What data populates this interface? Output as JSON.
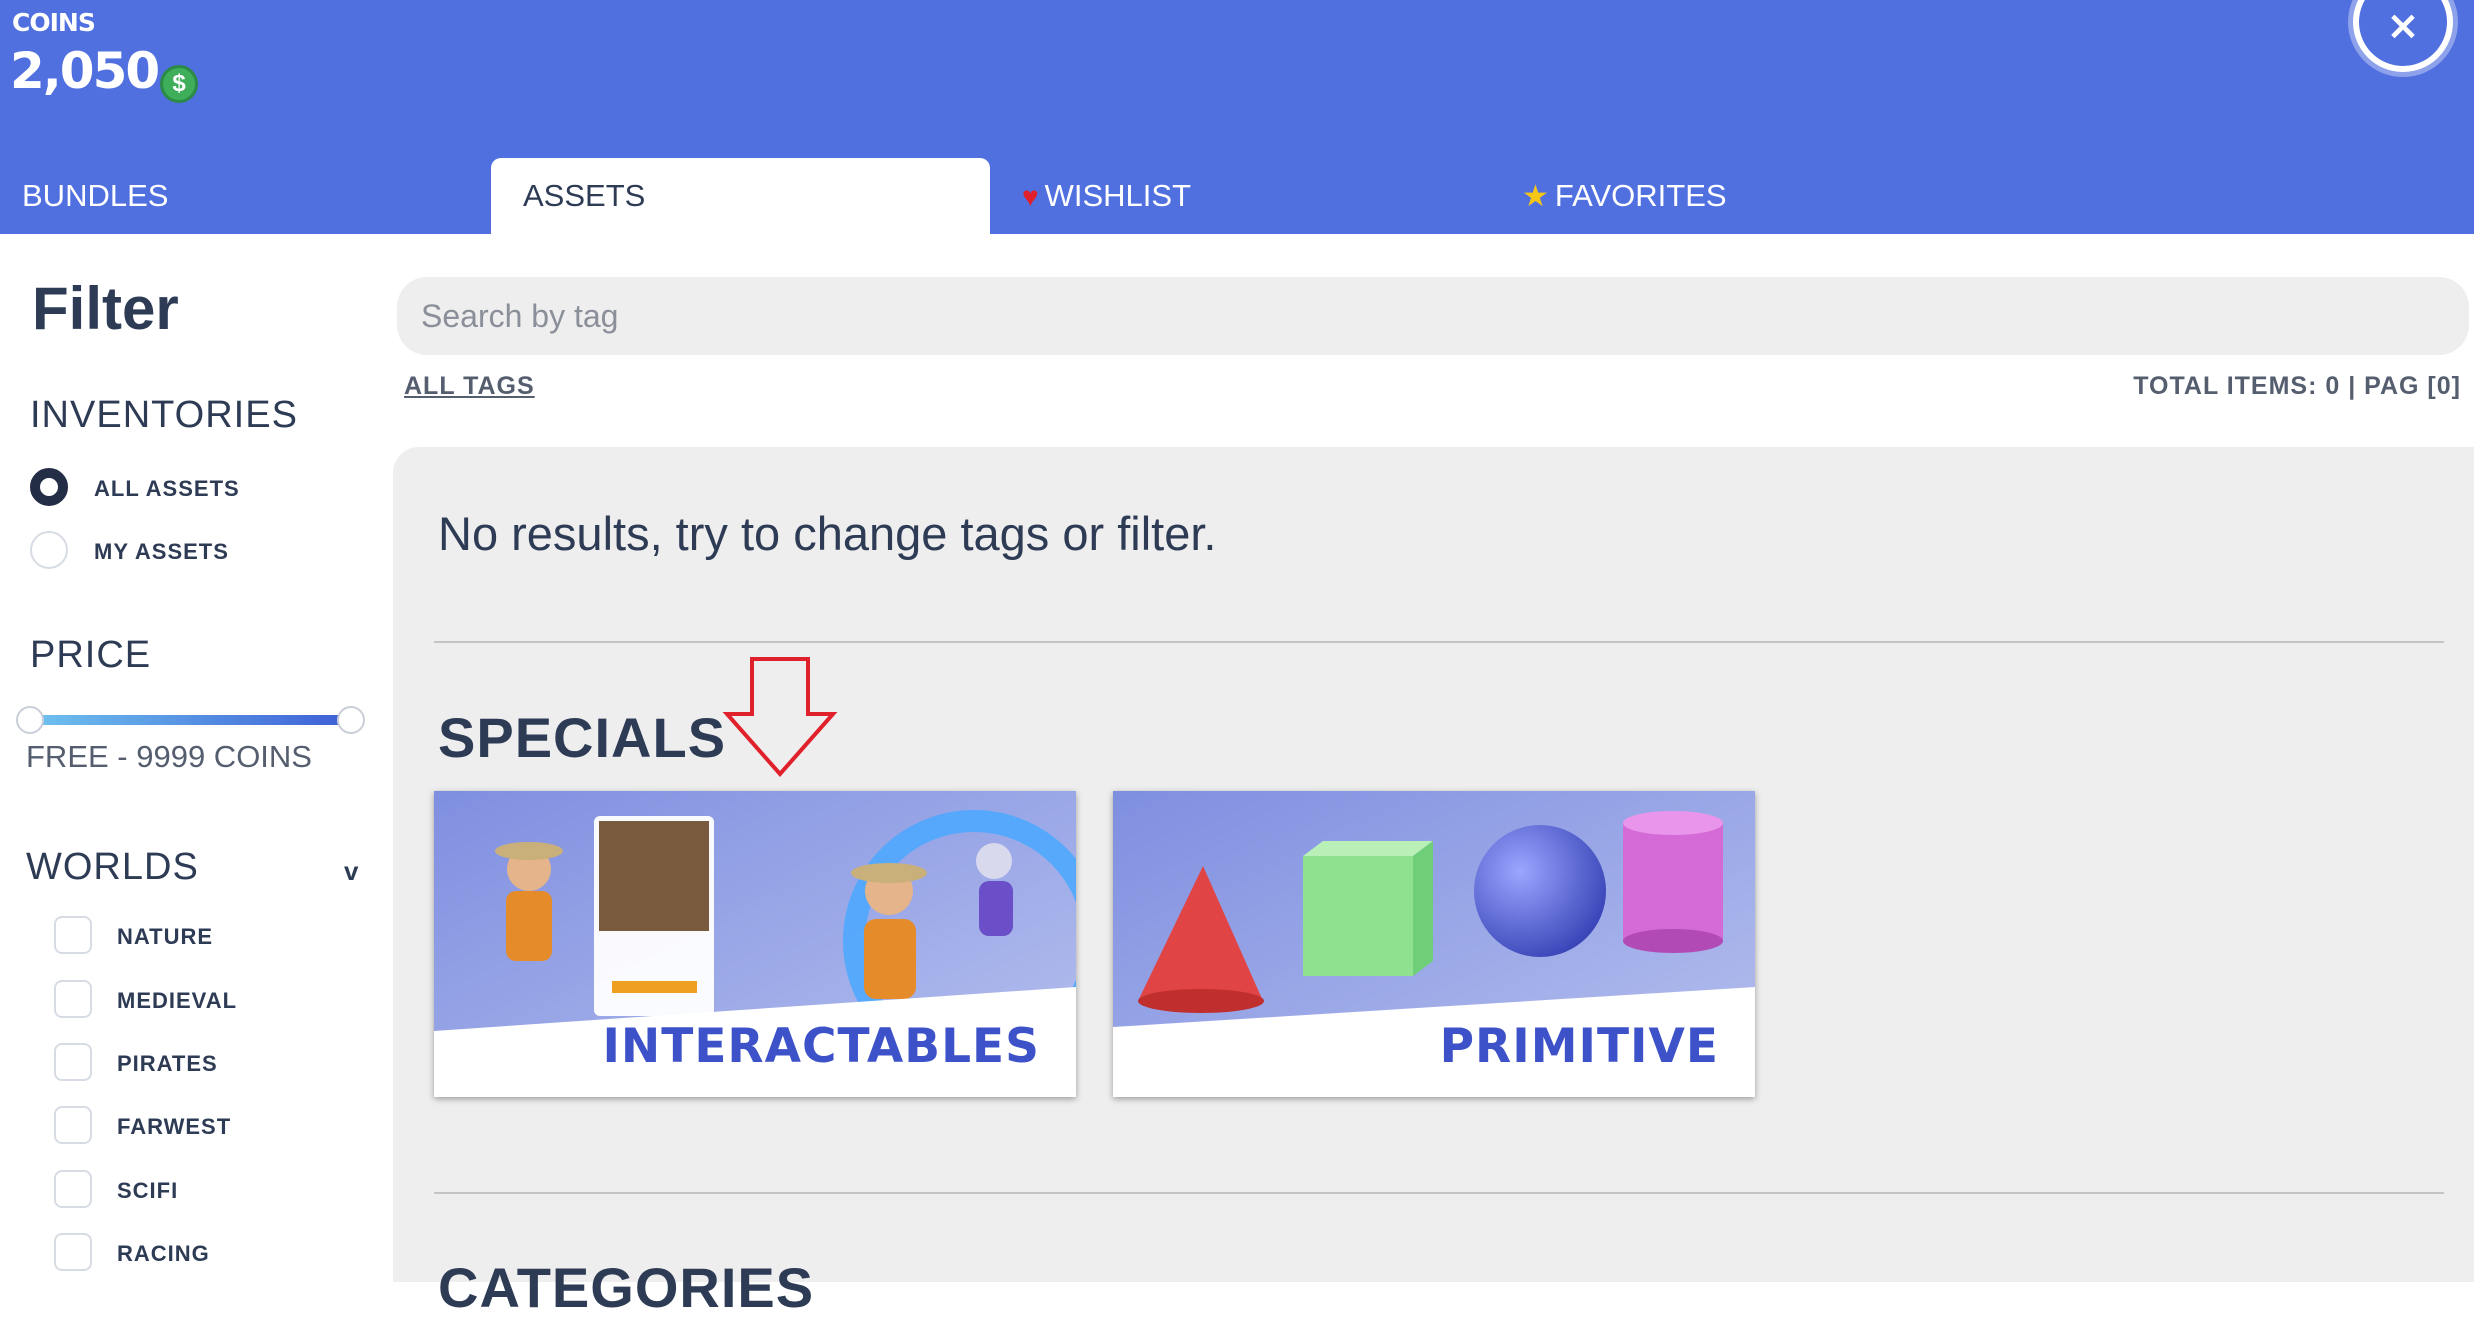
{
  "header": {
    "coins_label": "COINS",
    "coins_value": "2,050",
    "coin_icon": "dollar-coin-icon",
    "close_icon": "close-icon",
    "close_symbol": "×"
  },
  "tabs": [
    {
      "label": "BUNDLES",
      "active": false
    },
    {
      "label": "ASSETS",
      "active": true
    },
    {
      "label": "WISHLIST",
      "icon": "heart-icon",
      "active": false
    },
    {
      "label": "FAVORITES",
      "icon": "star-icon",
      "active": false
    }
  ],
  "sidebar": {
    "title": "Filter",
    "inventories": {
      "title": "INVENTORIES",
      "options": [
        {
          "label": "ALL ASSETS",
          "selected": true
        },
        {
          "label": "MY ASSETS",
          "selected": false
        }
      ]
    },
    "price": {
      "title": "PRICE",
      "range_text": "FREE - 9999 COINS",
      "min_fraction": 0.0,
      "max_fraction": 1.0
    },
    "worlds": {
      "title": "WORLDS",
      "toggle": "v",
      "options": [
        {
          "label": "NATURE",
          "checked": false
        },
        {
          "label": "MEDIEVAL",
          "checked": false
        },
        {
          "label": "PIRATES",
          "checked": false
        },
        {
          "label": "FARWEST",
          "checked": false
        },
        {
          "label": "SCIFI",
          "checked": false
        },
        {
          "label": "RACING",
          "checked": false
        }
      ]
    }
  },
  "main": {
    "search_placeholder": "Search by tag",
    "all_tags": "ALL TAGS",
    "total_items": "TOTAL ITEMS: 0 | PAG [0]",
    "no_results": "No results, try to change tags or filter.",
    "specials_title": "SPECIALS",
    "specials": [
      {
        "label": "INTERACTABLES"
      },
      {
        "label": "PRIMITIVE"
      }
    ],
    "categories_title": "CATEGORIES"
  },
  "colors": {
    "header_bg": "#5170e0",
    "text_dark": "#2e3b55",
    "panel_bg": "#eeeeee",
    "card_label": "#3d52c9",
    "annotation_arrow": "#e0202a"
  }
}
